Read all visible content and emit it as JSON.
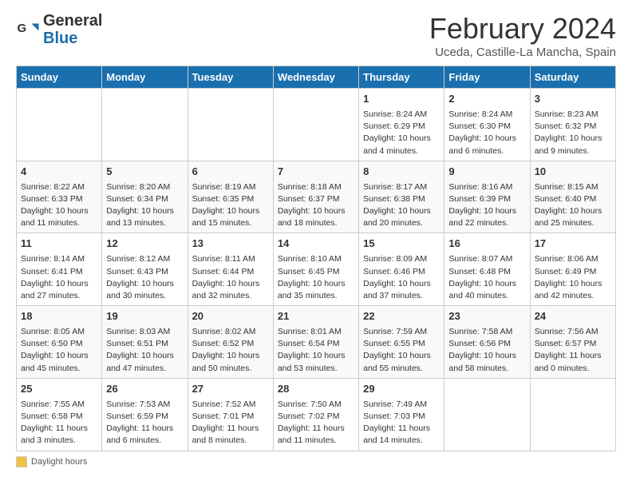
{
  "header": {
    "logo_line1": "General",
    "logo_line2": "Blue",
    "month": "February 2024",
    "location": "Uceda, Castille-La Mancha, Spain"
  },
  "days_of_week": [
    "Sunday",
    "Monday",
    "Tuesday",
    "Wednesday",
    "Thursday",
    "Friday",
    "Saturday"
  ],
  "weeks": [
    [
      {
        "day": "",
        "info": ""
      },
      {
        "day": "",
        "info": ""
      },
      {
        "day": "",
        "info": ""
      },
      {
        "day": "",
        "info": ""
      },
      {
        "day": "1",
        "info": "Sunrise: 8:24 AM\nSunset: 6:29 PM\nDaylight: 10 hours\nand 4 minutes."
      },
      {
        "day": "2",
        "info": "Sunrise: 8:24 AM\nSunset: 6:30 PM\nDaylight: 10 hours\nand 6 minutes."
      },
      {
        "day": "3",
        "info": "Sunrise: 8:23 AM\nSunset: 6:32 PM\nDaylight: 10 hours\nand 9 minutes."
      }
    ],
    [
      {
        "day": "4",
        "info": "Sunrise: 8:22 AM\nSunset: 6:33 PM\nDaylight: 10 hours\nand 11 minutes."
      },
      {
        "day": "5",
        "info": "Sunrise: 8:20 AM\nSunset: 6:34 PM\nDaylight: 10 hours\nand 13 minutes."
      },
      {
        "day": "6",
        "info": "Sunrise: 8:19 AM\nSunset: 6:35 PM\nDaylight: 10 hours\nand 15 minutes."
      },
      {
        "day": "7",
        "info": "Sunrise: 8:18 AM\nSunset: 6:37 PM\nDaylight: 10 hours\nand 18 minutes."
      },
      {
        "day": "8",
        "info": "Sunrise: 8:17 AM\nSunset: 6:38 PM\nDaylight: 10 hours\nand 20 minutes."
      },
      {
        "day": "9",
        "info": "Sunrise: 8:16 AM\nSunset: 6:39 PM\nDaylight: 10 hours\nand 22 minutes."
      },
      {
        "day": "10",
        "info": "Sunrise: 8:15 AM\nSunset: 6:40 PM\nDaylight: 10 hours\nand 25 minutes."
      }
    ],
    [
      {
        "day": "11",
        "info": "Sunrise: 8:14 AM\nSunset: 6:41 PM\nDaylight: 10 hours\nand 27 minutes."
      },
      {
        "day": "12",
        "info": "Sunrise: 8:12 AM\nSunset: 6:43 PM\nDaylight: 10 hours\nand 30 minutes."
      },
      {
        "day": "13",
        "info": "Sunrise: 8:11 AM\nSunset: 6:44 PM\nDaylight: 10 hours\nand 32 minutes."
      },
      {
        "day": "14",
        "info": "Sunrise: 8:10 AM\nSunset: 6:45 PM\nDaylight: 10 hours\nand 35 minutes."
      },
      {
        "day": "15",
        "info": "Sunrise: 8:09 AM\nSunset: 6:46 PM\nDaylight: 10 hours\nand 37 minutes."
      },
      {
        "day": "16",
        "info": "Sunrise: 8:07 AM\nSunset: 6:48 PM\nDaylight: 10 hours\nand 40 minutes."
      },
      {
        "day": "17",
        "info": "Sunrise: 8:06 AM\nSunset: 6:49 PM\nDaylight: 10 hours\nand 42 minutes."
      }
    ],
    [
      {
        "day": "18",
        "info": "Sunrise: 8:05 AM\nSunset: 6:50 PM\nDaylight: 10 hours\nand 45 minutes."
      },
      {
        "day": "19",
        "info": "Sunrise: 8:03 AM\nSunset: 6:51 PM\nDaylight: 10 hours\nand 47 minutes."
      },
      {
        "day": "20",
        "info": "Sunrise: 8:02 AM\nSunset: 6:52 PM\nDaylight: 10 hours\nand 50 minutes."
      },
      {
        "day": "21",
        "info": "Sunrise: 8:01 AM\nSunset: 6:54 PM\nDaylight: 10 hours\nand 53 minutes."
      },
      {
        "day": "22",
        "info": "Sunrise: 7:59 AM\nSunset: 6:55 PM\nDaylight: 10 hours\nand 55 minutes."
      },
      {
        "day": "23",
        "info": "Sunrise: 7:58 AM\nSunset: 6:56 PM\nDaylight: 10 hours\nand 58 minutes."
      },
      {
        "day": "24",
        "info": "Sunrise: 7:56 AM\nSunset: 6:57 PM\nDaylight: 11 hours\nand 0 minutes."
      }
    ],
    [
      {
        "day": "25",
        "info": "Sunrise: 7:55 AM\nSunset: 6:58 PM\nDaylight: 11 hours\nand 3 minutes."
      },
      {
        "day": "26",
        "info": "Sunrise: 7:53 AM\nSunset: 6:59 PM\nDaylight: 11 hours\nand 6 minutes."
      },
      {
        "day": "27",
        "info": "Sunrise: 7:52 AM\nSunset: 7:01 PM\nDaylight: 11 hours\nand 8 minutes."
      },
      {
        "day": "28",
        "info": "Sunrise: 7:50 AM\nSunset: 7:02 PM\nDaylight: 11 hours\nand 11 minutes."
      },
      {
        "day": "29",
        "info": "Sunrise: 7:49 AM\nSunset: 7:03 PM\nDaylight: 11 hours\nand 14 minutes."
      },
      {
        "day": "",
        "info": ""
      },
      {
        "day": "",
        "info": ""
      }
    ]
  ],
  "legend": {
    "box_color": "#f0c040",
    "label": "Daylight hours"
  }
}
